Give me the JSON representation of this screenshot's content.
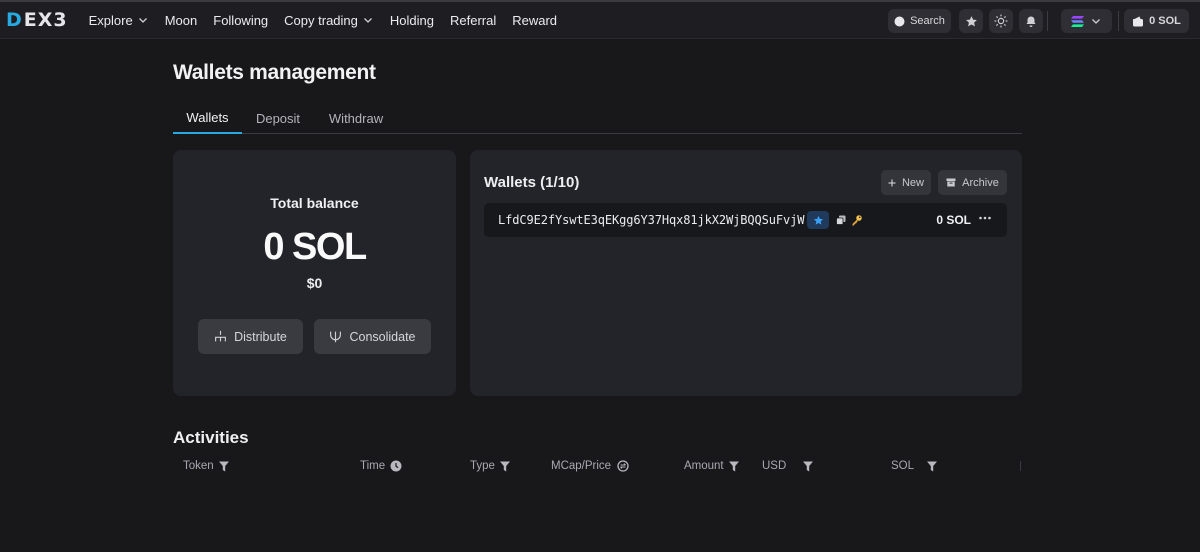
{
  "brand": {
    "logo_text": "EX3",
    "logo_initial": "D"
  },
  "nav": [
    {
      "label": "Explore",
      "dropdown": true
    },
    {
      "label": "Moon",
      "dropdown": false
    },
    {
      "label": "Following",
      "dropdown": false
    },
    {
      "label": "Copy trading",
      "dropdown": true
    },
    {
      "label": "Holding",
      "dropdown": false
    },
    {
      "label": "Referral",
      "dropdown": false
    },
    {
      "label": "Reward",
      "dropdown": false
    }
  ],
  "topbar": {
    "search_label": "Search",
    "wallet_balance": "0 SOL"
  },
  "page": {
    "title": "Wallets management",
    "tabs": [
      {
        "label": "Wallets",
        "active": true
      },
      {
        "label": "Deposit",
        "active": false
      },
      {
        "label": "Withdraw",
        "active": false
      }
    ]
  },
  "balance": {
    "label": "Total balance",
    "amount": "0 SOL",
    "usd": "$0",
    "distribute_label": "Distribute",
    "consolidate_label": "Consolidate"
  },
  "wallets": {
    "title": "Wallets (1/10)",
    "new_label": "New",
    "archive_label": "Archive",
    "items": [
      {
        "address": "LfdC9E2fYswtE3qEKgg6Y37Hqx81jkX2WjBQQSuFvjW",
        "balance": "0 SOL",
        "starred": true
      }
    ]
  },
  "activities": {
    "title": "Activities",
    "columns": [
      {
        "label": "Token",
        "icon": "filter-icon"
      },
      {
        "label": "Time",
        "icon": "clock-icon"
      },
      {
        "label": "Type",
        "icon": "filter-icon"
      },
      {
        "label": "MCap/Price",
        "icon": "swap-icon"
      },
      {
        "label": "Amount",
        "icon": "filter-icon"
      },
      {
        "label": "USD",
        "icon": "filter-icon"
      },
      {
        "label": "SOL",
        "icon": "filter-icon"
      }
    ]
  },
  "colors": {
    "background": "#18181b",
    "card": "#23242a",
    "accent": "#27a9e1"
  }
}
